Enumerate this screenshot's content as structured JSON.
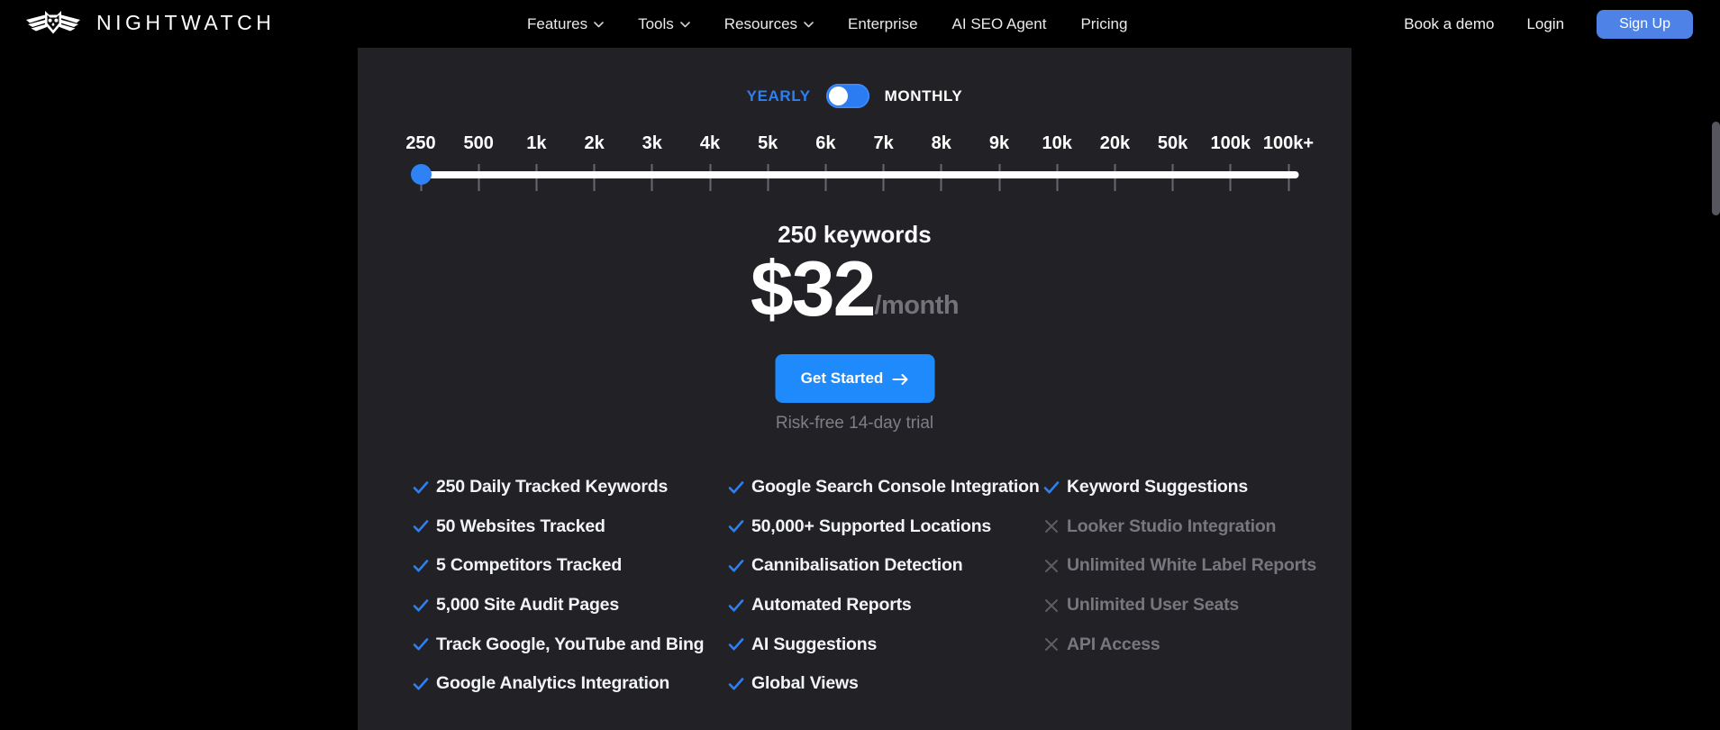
{
  "header": {
    "brand": "NIGHTWATCH",
    "nav": [
      {
        "label": "Features",
        "has_dropdown": true
      },
      {
        "label": "Tools",
        "has_dropdown": true
      },
      {
        "label": "Resources",
        "has_dropdown": true
      },
      {
        "label": "Enterprise",
        "has_dropdown": false
      },
      {
        "label": "AI SEO Agent",
        "has_dropdown": false
      },
      {
        "label": "Pricing",
        "has_dropdown": false
      }
    ],
    "book_demo_label": "Book a demo",
    "login_label": "Login",
    "signup_label": "Sign Up"
  },
  "pricing": {
    "billing": {
      "yearly_label": "YEARLY",
      "monthly_label": "MONTHLY",
      "selected": "YEARLY"
    },
    "slider": {
      "labels": [
        "250",
        "500",
        "1k",
        "2k",
        "3k",
        "4k",
        "5k",
        "6k",
        "7k",
        "8k",
        "9k",
        "10k",
        "20k",
        "50k",
        "100k",
        "100k+"
      ],
      "selected_value": "250"
    },
    "keywords_label": "250 keywords",
    "price_amount": "$32",
    "price_period": "/month",
    "cta_label": "Get Started",
    "trial_note": "Risk-free 14-day trial",
    "feature_columns": [
      {
        "items": [
          {
            "label": "250 Daily Tracked Keywords",
            "included": true
          },
          {
            "label": "50 Websites Tracked",
            "included": true
          },
          {
            "label": "5 Competitors Tracked",
            "included": true
          },
          {
            "label": "5,000 Site Audit Pages",
            "included": true
          },
          {
            "label": "Track Google, YouTube and Bing",
            "included": true
          },
          {
            "label": "Google Analytics Integration",
            "included": true
          }
        ]
      },
      {
        "items": [
          {
            "label": "Google Search Console Integration",
            "included": true
          },
          {
            "label": "50,000+ Supported Locations",
            "included": true
          },
          {
            "label": "Cannibalisation Detection",
            "included": true
          },
          {
            "label": "Automated Reports",
            "included": true
          },
          {
            "label": "AI Suggestions",
            "included": true
          },
          {
            "label": "Global Views",
            "included": true
          }
        ]
      },
      {
        "items": [
          {
            "label": "Keyword Suggestions",
            "included": true
          },
          {
            "label": "Looker Studio Integration",
            "included": false
          },
          {
            "label": "Unlimited White Label Reports",
            "included": false
          },
          {
            "label": "Unlimited User Seats",
            "included": false
          },
          {
            "label": "API Access",
            "included": false
          }
        ]
      }
    ]
  },
  "colors": {
    "page_bg": "#000000",
    "panel_bg": "#222226",
    "accent_blue": "#2e7ff2",
    "cta_blue": "#1f8afc",
    "signup_blue": "#4e82e6",
    "muted_text": "#7e7e85",
    "excluded_text": "#77777e"
  }
}
